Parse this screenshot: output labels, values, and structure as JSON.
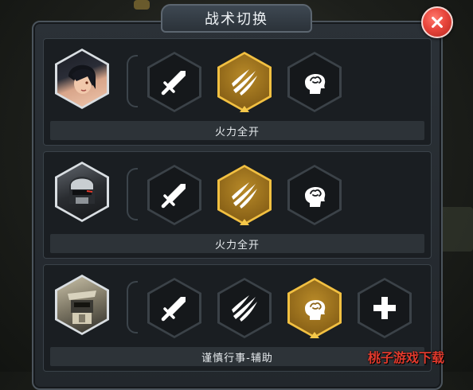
{
  "title": "战术切换",
  "close": {
    "icon": "close-x-icon"
  },
  "rows": [
    {
      "portrait": "female-agent-portrait",
      "skills": [
        {
          "icon": "sword-icon",
          "active": false
        },
        {
          "icon": "claw-slash-icon",
          "active": true
        },
        {
          "icon": "brain-head-icon",
          "active": false
        }
      ],
      "label": "火力全开"
    },
    {
      "portrait": "robot-head-portrait",
      "skills": [
        {
          "icon": "sword-icon",
          "active": false
        },
        {
          "icon": "claw-slash-icon",
          "active": true
        },
        {
          "icon": "brain-head-icon",
          "active": false
        }
      ],
      "label": "火力全开"
    },
    {
      "portrait": "mech-portrait",
      "skills": [
        {
          "icon": "sword-icon",
          "active": false
        },
        {
          "icon": "claw-slash-icon",
          "active": false
        },
        {
          "icon": "brain-head-icon",
          "active": true
        },
        {
          "icon": "plus-icon",
          "active": false
        }
      ],
      "label": "谨慎行事-辅助"
    }
  ],
  "watermark": "桃子游戏下载",
  "colors": {
    "active_border": "#f2c041",
    "close": "#e8463c"
  }
}
